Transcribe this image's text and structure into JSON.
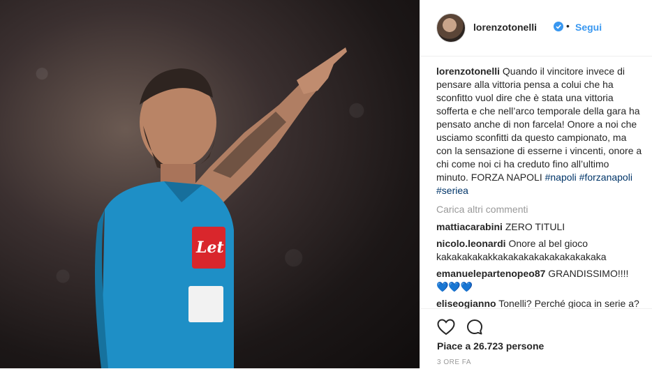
{
  "post": {
    "author": "lorenzotonelli",
    "separator": "•",
    "follow_label": "Segui",
    "caption": "Quando il vincitore invece di pensare alla vittoria pensa a colui che ha sconfitto vuol dire che è stata una vittoria sofferta e che nell’arco temporale della gara ha pensato anche di non farcela! Onore a noi che usciamo sconfitti da questo campionato, ma con la sensazione di esserne i vincenti, onore a chi come noi ci ha creduto fino all’ultimo minuto. FORZA NAPOLI",
    "hashtags": [
      "#napoli",
      "#forzanapoli",
      "#seriea"
    ],
    "load_more": "Carica altri commenti",
    "comments": [
      {
        "user": "mattiacarabini",
        "text": "ZERO TITULI"
      },
      {
        "user": "nicolo.leonardi",
        "text": "Onore al bel gioco kakakakakakkakakakakakakakakakaka"
      },
      {
        "user": "emanuelepartenopeo87",
        "text": "GRANDISSIMO!!!! 💙💙💙"
      },
      {
        "user": "eliseogianno",
        "text": "Tonelli? Perché gioca in serie a?"
      }
    ],
    "likes": "Piace a 26.723 persone",
    "time": "3 ORE FA"
  },
  "colors": {
    "link_blue": "#3897f0",
    "hashtag": "#003569",
    "text": "#262626",
    "muted": "#999999"
  },
  "icons": [
    "verified-badge-icon",
    "heart-icon",
    "comment-icon"
  ]
}
